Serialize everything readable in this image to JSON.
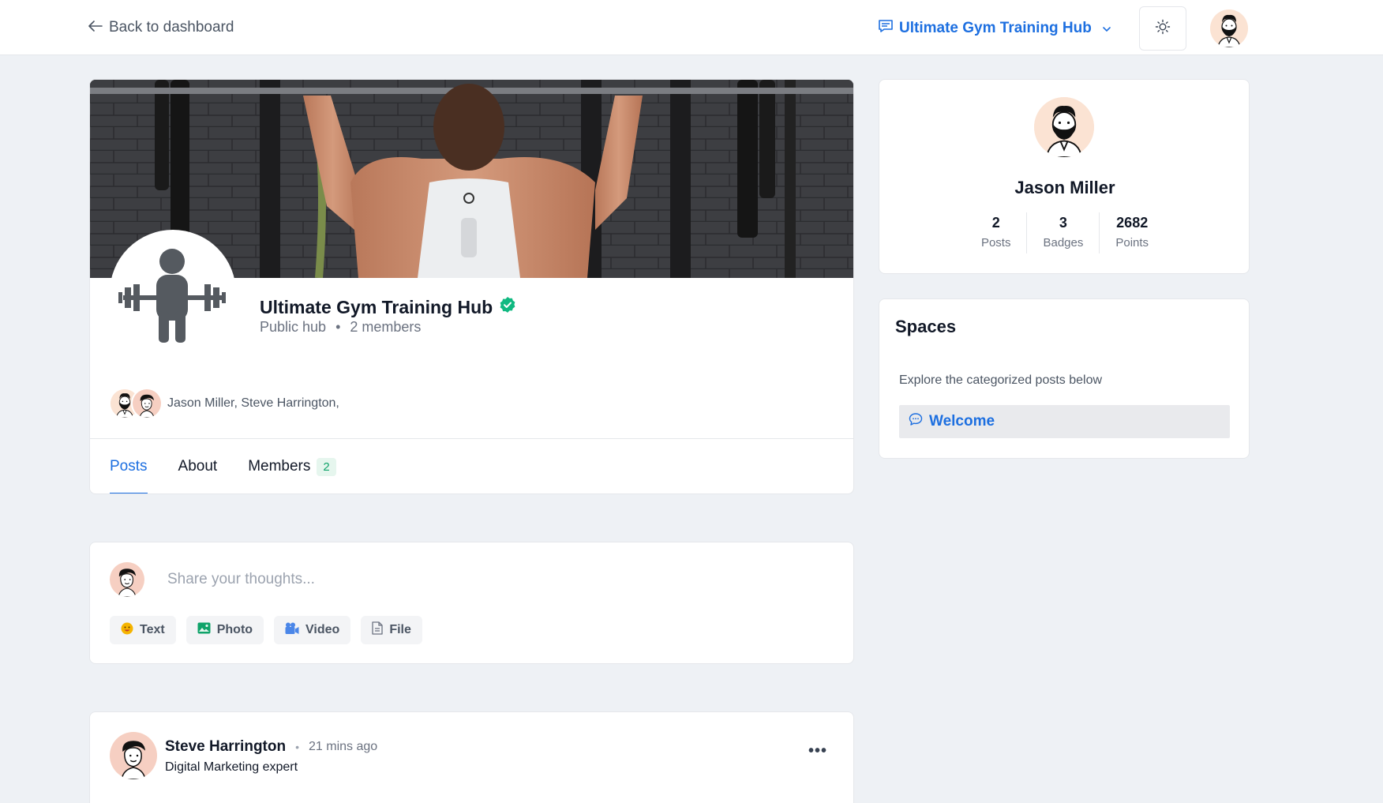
{
  "topbar": {
    "back_label": "Back to dashboard",
    "hub_switcher_label": "Ultimate Gym Training Hub"
  },
  "hub": {
    "title": "Ultimate Gym Training Hub",
    "privacy": "Public hub",
    "member_count": "2 members",
    "member_names": "Jason Miller, Steve Harrington,",
    "tabs": [
      {
        "label": "Posts"
      },
      {
        "label": "About"
      },
      {
        "label": "Members",
        "count": "2"
      }
    ]
  },
  "composer": {
    "placeholder": "Share your thoughts...",
    "actions": [
      {
        "label": "Text",
        "icon": "emoji-icon"
      },
      {
        "label": "Photo",
        "icon": "photo-icon"
      },
      {
        "label": "Video",
        "icon": "video-icon"
      },
      {
        "label": "File",
        "icon": "file-icon"
      }
    ]
  },
  "post": {
    "author": "Steve Harrington",
    "time": "21 mins ago",
    "role": "Digital Marketing expert"
  },
  "profile": {
    "name": "Jason Miller",
    "stats": [
      {
        "value": "2",
        "label": "Posts"
      },
      {
        "value": "3",
        "label": "Badges"
      },
      {
        "value": "2682",
        "label": "Points"
      }
    ]
  },
  "spaces": {
    "title": "Spaces",
    "description": "Explore the categorized posts below",
    "items": [
      {
        "label": "Welcome"
      }
    ]
  },
  "colors": {
    "accent": "#1d6fe0",
    "verified": "#10b981",
    "background": "#eef1f5"
  }
}
